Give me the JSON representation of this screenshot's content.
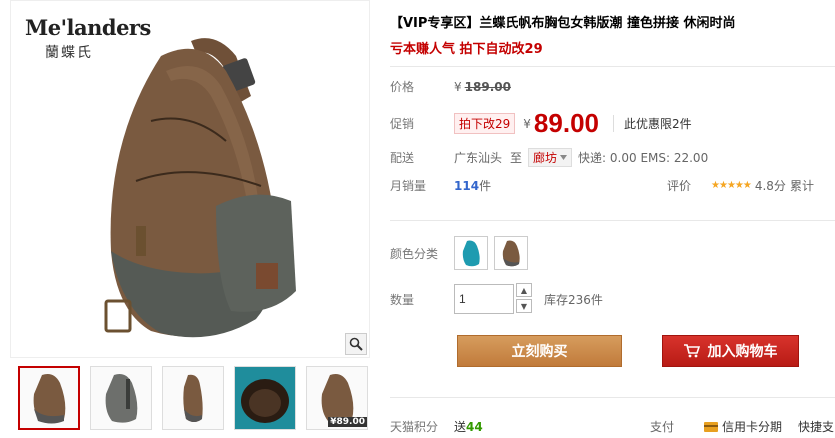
{
  "brand": {
    "name_en": "Me'landers",
    "name_cn": "蘭蝶氏"
  },
  "product": {
    "title": "【VIP专享区】兰蝶氏帆布胸包女韩版潮 撞色拼接 休闲时尚",
    "subtitle": "亏本赚人气 拍下自动改29"
  },
  "price": {
    "label": "价格",
    "currency": "¥",
    "original": "189.00",
    "promo_label": "促销",
    "promo_tag": "拍下改29",
    "current": "89.00",
    "limit_text": "此优惠限2件"
  },
  "shipping": {
    "label": "配送",
    "origin": "广东汕头",
    "to": "至",
    "destination": "廊坊",
    "fees": "快递: 0.00 EMS: 22.00"
  },
  "sales": {
    "label": "月销量",
    "count": "114",
    "unit": "件",
    "rating_label": "评价",
    "stars": "★★★★★",
    "score": "4.8分",
    "cumulative": "累计"
  },
  "variant": {
    "label": "颜色分类"
  },
  "quantity": {
    "label": "数量",
    "value": "1",
    "stock": "库存236件"
  },
  "buttons": {
    "buy_now": "立刻购买",
    "add_to_cart": "加入购物车"
  },
  "footer": {
    "points_label": "天猫积分",
    "points_prefix": "送",
    "points_value": "44",
    "pay_label": "支付",
    "installment": "信用卡分期",
    "quick": "快捷支"
  },
  "thumbs": {
    "price_tag": "¥89.00"
  },
  "colors": {
    "price_red": "#c40000",
    "buy_orange": "#c9894a",
    "cart_red": "#c81f18"
  }
}
